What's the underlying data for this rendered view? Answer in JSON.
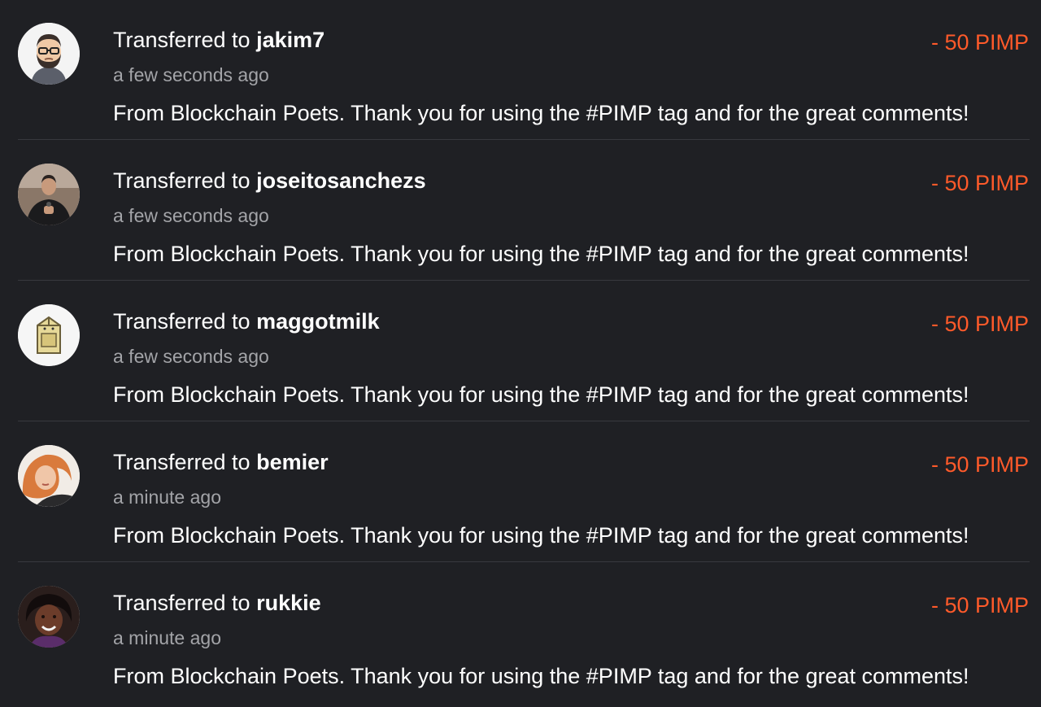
{
  "transfers": [
    {
      "prefix": "Transferred to ",
      "user": "jakim7",
      "time": "a few seconds ago",
      "memo": "From Blockchain Poets. Thank you for using the #PIMP tag and for the great comments!",
      "amount": "- 50 PIMP",
      "avatar_icon": "bearded-man-glasses-avatar"
    },
    {
      "prefix": "Transferred to ",
      "user": "joseitosanchezs",
      "time": "a few seconds ago",
      "memo": "From Blockchain Poets. Thank you for using the #PIMP tag and for the great comments!",
      "amount": "- 50 PIMP",
      "avatar_icon": "man-photo-avatar"
    },
    {
      "prefix": "Transferred to ",
      "user": "maggotmilk",
      "time": "a few seconds ago",
      "memo": "From Blockchain Poets. Thank you for using the #PIMP tag and for the great comments!",
      "amount": "- 50 PIMP",
      "avatar_icon": "milk-carton-avatar"
    },
    {
      "prefix": "Transferred to ",
      "user": "bemier",
      "time": "a minute ago",
      "memo": "From Blockchain Poets. Thank you for using the #PIMP tag and for the great comments!",
      "amount": "- 50 PIMP",
      "avatar_icon": "woman-red-hair-avatar"
    },
    {
      "prefix": "Transferred to ",
      "user": "rukkie",
      "time": "a minute ago",
      "memo": "From Blockchain Poets. Thank you for using the #PIMP tag and for the great comments!",
      "amount": "- 50 PIMP",
      "avatar_icon": "woman-smiling-avatar"
    }
  ],
  "colors": {
    "background": "#1f2024",
    "amount": "#ff5a2a",
    "secondary_text": "#a3a4a8",
    "divider": "#38393e"
  }
}
